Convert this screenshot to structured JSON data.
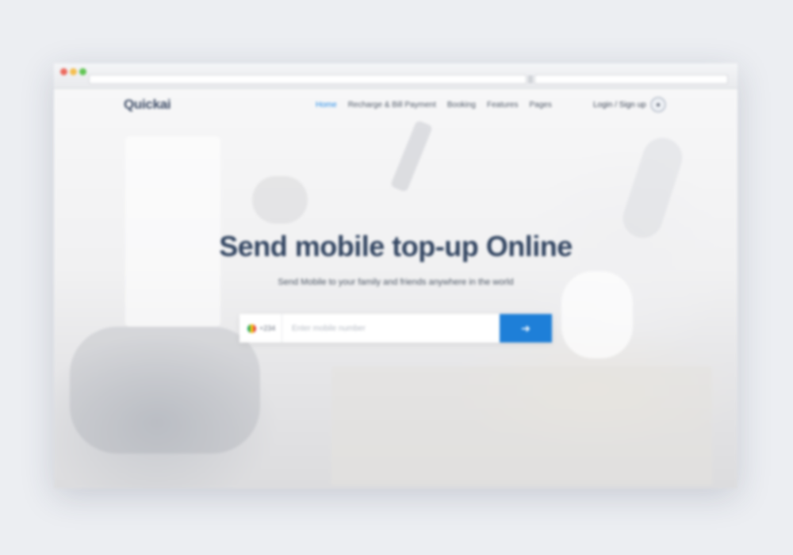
{
  "site": {
    "logo": "Quickai"
  },
  "nav": {
    "links": [
      {
        "label": "Home",
        "active": true
      },
      {
        "label": "Recharge & Bill Payment",
        "active": false
      },
      {
        "label": "Booking",
        "active": false
      },
      {
        "label": "Features",
        "active": false
      },
      {
        "label": "Pages",
        "active": false
      }
    ],
    "auth": "Login / Sign up"
  },
  "hero": {
    "title": "Send mobile top-up Online",
    "subtitle": "Send Mobile to your family and friends anywhere in the world"
  },
  "search": {
    "country_code": "+234",
    "placeholder": "Enter mobile number",
    "button_icon": "arrow-right-icon"
  },
  "colors": {
    "accent": "#1e7fd8",
    "title": "#334662",
    "background": "#eceef2"
  }
}
